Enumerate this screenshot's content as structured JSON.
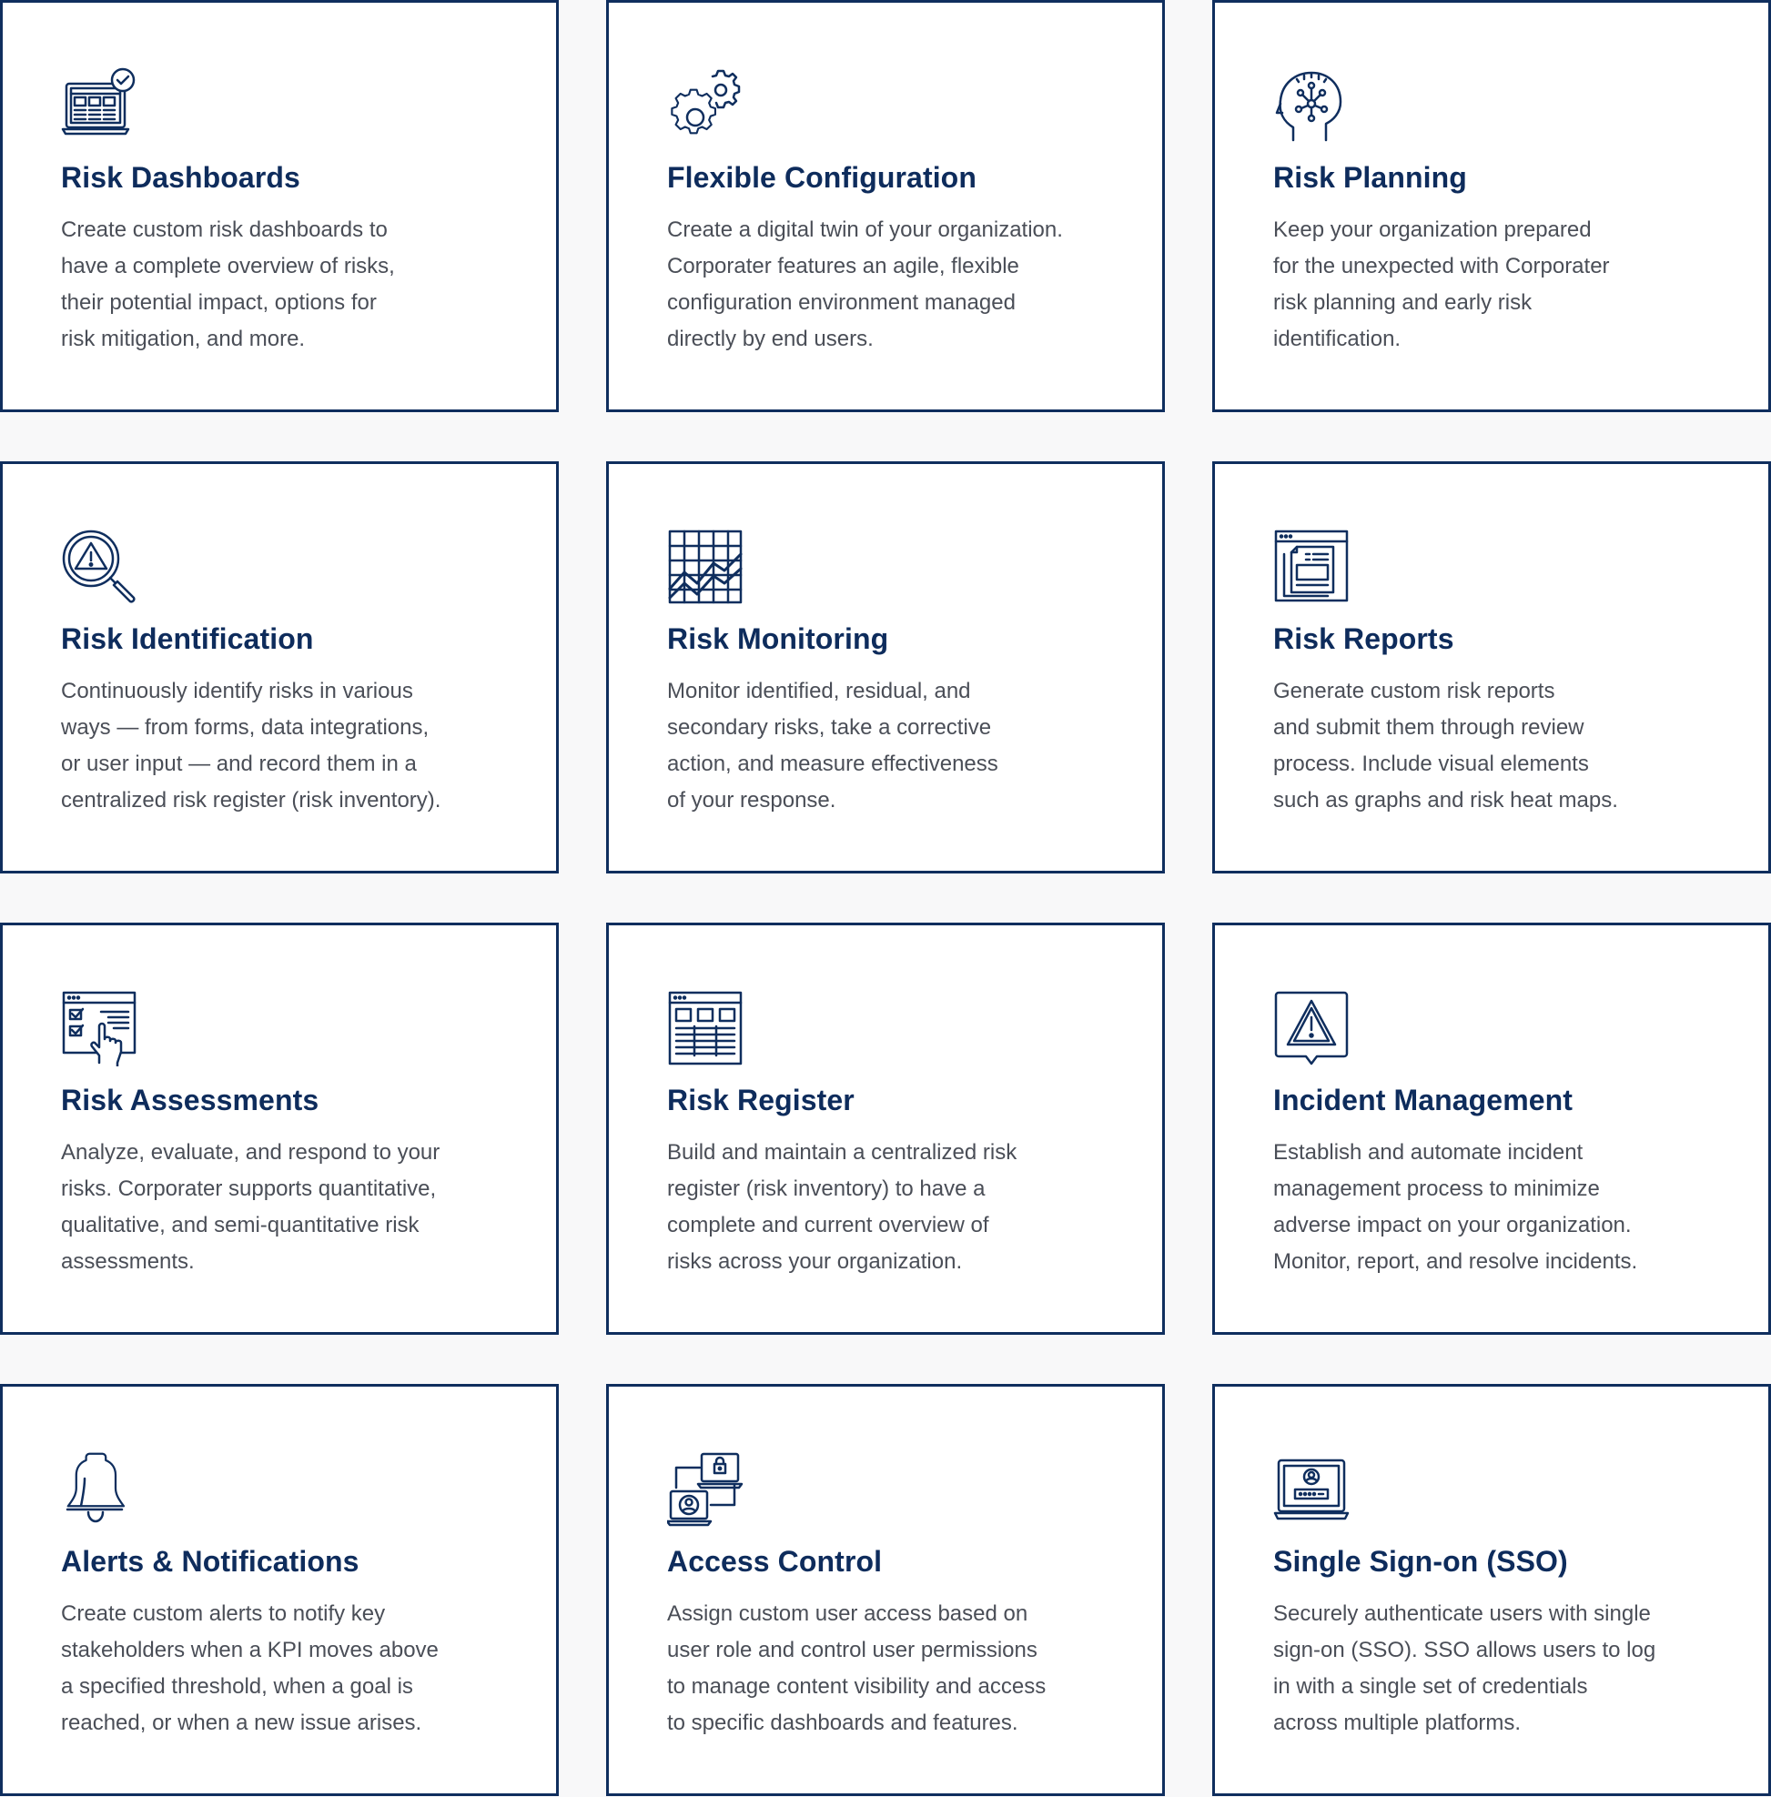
{
  "colors": {
    "card_border": "#0f2e5e",
    "title": "#0e2c5c",
    "text": "#4a4e57",
    "page_background": "#f8f8f9"
  },
  "cards": [
    {
      "icon": "laptop-dashboard-check-icon",
      "title": "Risk Dashboards",
      "lines": [
        "Create custom risk dashboards to",
        "have a complete overview of risks,",
        "their potential impact, options for",
        "risk mitigation, and more."
      ]
    },
    {
      "icon": "gears-icon",
      "title": "Flexible Configuration",
      "lines": [
        "Create a digital twin of your organization.",
        "Corporater features an agile, flexible",
        "configuration environment managed",
        "directly by end users."
      ]
    },
    {
      "icon": "head-network-icon",
      "title": "Risk Planning",
      "lines": [
        "Keep your organization prepared",
        "for the unexpected with Corporater",
        "risk planning and early risk",
        "identification."
      ]
    },
    {
      "icon": "magnifier-warning-icon",
      "title": "Risk Identification",
      "lines": [
        "Continuously identify risks in various",
        "ways — from forms, data integrations,",
        "or user input — and record them in a",
        "centralized risk register (risk inventory)."
      ]
    },
    {
      "icon": "grid-trend-chart-icon",
      "title": "Risk Monitoring",
      "lines": [
        "Monitor identified, residual, and",
        "secondary risks, take a corrective",
        "action, and measure effectiveness",
        "of your response."
      ]
    },
    {
      "icon": "report-window-icon",
      "title": "Risk Reports",
      "lines": [
        "Generate custom risk reports",
        "and submit them through review",
        "process. Include visual elements",
        "such as graphs and risk heat maps."
      ]
    },
    {
      "icon": "checklist-hand-icon",
      "title": "Risk Assessments",
      "lines": [
        "Analyze, evaluate, and respond to your",
        "risks. Corporater supports quantitative,",
        "qualitative, and semi-quantitative risk",
        "assessments."
      ]
    },
    {
      "icon": "register-table-icon",
      "title": "Risk Register",
      "lines": [
        "Build and maintain a centralized risk",
        "register (risk inventory) to have a",
        "complete and current overview of",
        "risks across your organization."
      ]
    },
    {
      "icon": "warning-message-icon",
      "title": "Incident Management",
      "lines": [
        "Establish and automate incident",
        "management process to minimize",
        "adverse impact on your organization.",
        "Monitor, report, and resolve incidents."
      ]
    },
    {
      "icon": "bell-icon",
      "title": "Alerts & Notifications",
      "lines": [
        "Create custom alerts to notify key",
        "stakeholders when a KPI moves above",
        "a specified threshold, when a goal is",
        "reached, or when a new issue arises."
      ]
    },
    {
      "icon": "access-devices-lock-icon",
      "title": "Access Control",
      "lines": [
        "Assign custom user access based on",
        "user role and control user permissions",
        "to manage content visibility and access",
        "to specific dashboards and features."
      ]
    },
    {
      "icon": "laptop-login-icon",
      "title": "Single Sign-on (SSO)",
      "lines": [
        "Securely authenticate users with single",
        "sign-on (SSO). SSO allows users to log",
        "in with a single set of credentials",
        "across multiple platforms."
      ]
    }
  ]
}
